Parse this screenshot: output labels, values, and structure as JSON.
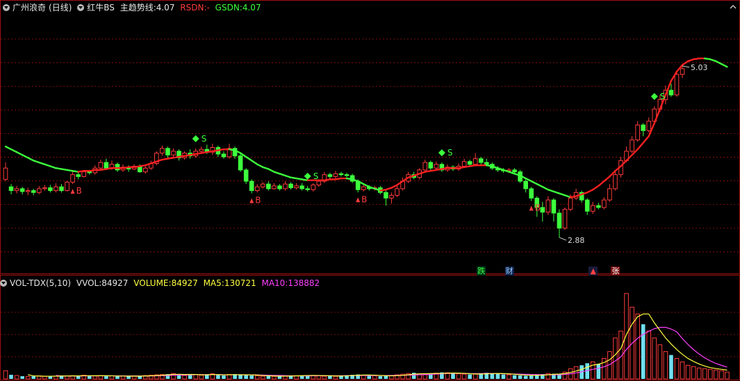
{
  "header": {
    "stock_name": "广州浪奇",
    "period": "(日线)",
    "indicator_name": "红牛BS",
    "trend_label": "主趋势线:",
    "trend_value": "4.07",
    "rsdn_label": "RSDN:",
    "rsdn_value": "-",
    "gsdn_label": "GSDN:",
    "gsdn_value": "4.07"
  },
  "volume_panel": {
    "indicator_name": "VOL-TDX(5,10)",
    "vvol_label": "VVOL:",
    "vvol_value": "84927",
    "volume_label": "VOLUME:",
    "volume_value": "84927",
    "ma5_label": "MA5:",
    "ma5_value": "130721",
    "ma10_label": "MA10:",
    "ma10_value": "138882"
  },
  "annotations": {
    "high_label": "5.03",
    "low_label": "2.88",
    "buy_label": "B",
    "sell_label": "S"
  },
  "event_badges": [
    {
      "text": "跌",
      "color": "#3cff3c",
      "bg": "#003a1a"
    },
    {
      "text": "财",
      "color": "#9ad0ff",
      "bg": "#10204a"
    },
    {
      "text": "▲",
      "color": "#ff4040",
      "bg": "#1a1a3a"
    },
    {
      "text": "张",
      "color": "#ffffff",
      "bg": "#7a0f0f"
    }
  ],
  "colors": {
    "up": "#ff3b3b",
    "down": "#3cff3c",
    "trend_up": "#ff2020",
    "trend_down": "#3cff3c",
    "volume_up": "#ff3b3b",
    "volume_down": "#70e0f0",
    "ma5": "#ffff40",
    "ma10": "#ff40ff",
    "grid": "#a01010"
  },
  "chart_data": [
    {
      "type": "candlestick",
      "title": "",
      "x_count": 130,
      "ylim": [
        2.6,
        5.25
      ],
      "price_high": 5.03,
      "price_low": 2.88,
      "candles": [
        [
          3.5,
          3.62,
          3.68,
          3.48
        ],
        [
          3.42,
          3.38,
          3.45,
          3.34
        ],
        [
          3.38,
          3.4,
          3.43,
          3.35
        ],
        [
          3.4,
          3.37,
          3.42,
          3.34
        ],
        [
          3.37,
          3.38,
          3.41,
          3.33
        ],
        [
          3.38,
          3.36,
          3.4,
          3.33
        ],
        [
          3.36,
          3.4,
          3.43,
          3.34
        ],
        [
          3.4,
          3.41,
          3.44,
          3.38
        ],
        [
          3.41,
          3.38,
          3.44,
          3.36
        ],
        [
          3.38,
          3.42,
          3.46,
          3.36
        ],
        [
          3.42,
          3.38,
          3.45,
          3.36
        ],
        [
          3.38,
          3.47,
          3.48,
          3.37
        ],
        [
          3.47,
          3.55,
          3.6,
          3.45
        ],
        [
          3.55,
          3.53,
          3.58,
          3.5
        ],
        [
          3.53,
          3.58,
          3.6,
          3.52
        ],
        [
          3.58,
          3.57,
          3.6,
          3.55
        ],
        [
          3.57,
          3.62,
          3.65,
          3.55
        ],
        [
          3.62,
          3.68,
          3.71,
          3.6
        ],
        [
          3.68,
          3.62,
          3.72,
          3.6
        ],
        [
          3.62,
          3.66,
          3.7,
          3.6
        ],
        [
          3.66,
          3.6,
          3.68,
          3.58
        ],
        [
          3.6,
          3.63,
          3.66,
          3.58
        ],
        [
          3.63,
          3.61,
          3.65,
          3.58
        ],
        [
          3.61,
          3.64,
          3.66,
          3.6
        ],
        [
          3.64,
          3.58,
          3.66,
          3.57
        ],
        [
          3.58,
          3.62,
          3.64,
          3.56
        ],
        [
          3.62,
          3.67,
          3.7,
          3.6
        ],
        [
          3.67,
          3.78,
          3.8,
          3.65
        ],
        [
          3.78,
          3.83,
          3.86,
          3.75
        ],
        [
          3.83,
          3.76,
          3.85,
          3.72
        ],
        [
          3.76,
          3.8,
          3.83,
          3.74
        ],
        [
          3.8,
          3.73,
          3.82,
          3.7
        ],
        [
          3.73,
          3.78,
          3.8,
          3.71
        ],
        [
          3.78,
          3.75,
          3.82,
          3.72
        ],
        [
          3.75,
          3.8,
          3.83,
          3.73
        ],
        [
          3.8,
          3.82,
          3.85,
          3.78
        ],
        [
          3.82,
          3.79,
          3.87,
          3.77
        ],
        [
          3.79,
          3.84,
          3.88,
          3.76
        ],
        [
          3.84,
          3.77,
          3.86,
          3.74
        ],
        [
          3.77,
          3.74,
          3.8,
          3.72
        ],
        [
          3.74,
          3.83,
          3.88,
          3.72
        ],
        [
          3.83,
          3.75,
          3.85,
          3.72
        ],
        [
          3.75,
          3.6,
          3.78,
          3.58
        ],
        [
          3.6,
          3.48,
          3.62,
          3.45
        ],
        [
          3.48,
          3.38,
          3.5,
          3.35
        ],
        [
          3.38,
          3.42,
          3.45,
          3.36
        ],
        [
          3.42,
          3.45,
          3.47,
          3.4
        ],
        [
          3.45,
          3.4,
          3.48,
          3.38
        ],
        [
          3.4,
          3.43,
          3.46,
          3.39
        ],
        [
          3.43,
          3.4,
          3.45,
          3.38
        ],
        [
          3.4,
          3.45,
          3.48,
          3.38
        ],
        [
          3.45,
          3.41,
          3.47,
          3.39
        ],
        [
          3.41,
          3.43,
          3.46,
          3.39
        ],
        [
          3.43,
          3.4,
          3.46,
          3.38
        ],
        [
          3.4,
          3.39,
          3.43,
          3.37
        ],
        [
          3.39,
          3.44,
          3.46,
          3.37
        ],
        [
          3.44,
          3.48,
          3.5,
          3.42
        ],
        [
          3.48,
          3.55,
          3.58,
          3.46
        ],
        [
          3.55,
          3.53,
          3.57,
          3.5
        ],
        [
          3.53,
          3.56,
          3.59,
          3.51
        ],
        [
          3.56,
          3.55,
          3.58,
          3.53
        ],
        [
          3.55,
          3.54,
          3.57,
          3.52
        ],
        [
          3.54,
          3.48,
          3.56,
          3.46
        ],
        [
          3.48,
          3.39,
          3.5,
          3.36
        ],
        [
          3.39,
          3.42,
          3.45,
          3.37
        ],
        [
          3.42,
          3.4,
          3.44,
          3.38
        ],
        [
          3.4,
          3.41,
          3.43,
          3.38
        ],
        [
          3.41,
          3.36,
          3.43,
          3.34
        ],
        [
          3.36,
          3.3,
          3.39,
          3.22
        ],
        [
          3.3,
          3.33,
          3.36,
          3.24
        ],
        [
          3.33,
          3.4,
          3.43,
          3.31
        ],
        [
          3.4,
          3.48,
          3.52,
          3.38
        ],
        [
          3.48,
          3.55,
          3.58,
          3.46
        ],
        [
          3.55,
          3.52,
          3.58,
          3.5
        ],
        [
          3.52,
          3.6,
          3.62,
          3.5
        ],
        [
          3.6,
          3.68,
          3.71,
          3.58
        ],
        [
          3.68,
          3.62,
          3.7,
          3.6
        ],
        [
          3.62,
          3.66,
          3.69,
          3.6
        ],
        [
          3.66,
          3.6,
          3.68,
          3.58
        ],
        [
          3.6,
          3.63,
          3.66,
          3.58
        ],
        [
          3.63,
          3.61,
          3.65,
          3.59
        ],
        [
          3.61,
          3.64,
          3.67,
          3.59
        ],
        [
          3.64,
          3.69,
          3.72,
          3.62
        ],
        [
          3.69,
          3.66,
          3.71,
          3.63
        ],
        [
          3.66,
          3.72,
          3.78,
          3.64
        ],
        [
          3.72,
          3.68,
          3.74,
          3.65
        ],
        [
          3.68,
          3.66,
          3.72,
          3.64
        ],
        [
          3.66,
          3.62,
          3.68,
          3.6
        ],
        [
          3.62,
          3.6,
          3.64,
          3.58
        ],
        [
          3.6,
          3.59,
          3.62,
          3.57
        ],
        [
          3.59,
          3.6,
          3.62,
          3.58
        ],
        [
          3.6,
          3.58,
          3.62,
          3.56
        ],
        [
          3.58,
          3.48,
          3.6,
          3.46
        ],
        [
          3.48,
          3.4,
          3.5,
          3.36
        ],
        [
          3.4,
          3.3,
          3.42,
          3.27
        ],
        [
          3.3,
          3.2,
          3.32,
          3.1
        ],
        [
          3.2,
          3.15,
          3.26,
          3.05
        ],
        [
          3.15,
          3.28,
          3.32,
          3.12
        ],
        [
          3.28,
          3.14,
          3.3,
          3.05
        ],
        [
          3.14,
          2.98,
          3.18,
          2.88
        ],
        [
          2.98,
          3.18,
          3.2,
          2.96
        ],
        [
          3.18,
          3.3,
          3.34,
          3.16
        ],
        [
          3.3,
          3.36,
          3.4,
          3.28
        ],
        [
          3.36,
          3.28,
          3.38,
          3.25
        ],
        [
          3.28,
          3.16,
          3.3,
          3.12
        ],
        [
          3.16,
          3.22,
          3.26,
          3.13
        ],
        [
          3.22,
          3.2,
          3.25,
          3.18
        ],
        [
          3.2,
          3.28,
          3.31,
          3.18
        ],
        [
          3.28,
          3.4,
          3.45,
          3.26
        ],
        [
          3.4,
          3.55,
          3.6,
          3.38
        ],
        [
          3.55,
          3.7,
          3.74,
          3.52
        ],
        [
          3.7,
          3.8,
          3.85,
          3.68
        ],
        [
          3.8,
          3.92,
          3.96,
          3.78
        ],
        [
          3.92,
          4.08,
          4.12,
          3.9
        ],
        [
          4.08,
          4.02,
          4.1,
          3.96
        ],
        [
          4.02,
          4.12,
          4.16,
          4.0
        ],
        [
          4.12,
          4.25,
          4.28,
          4.1
        ],
        [
          4.25,
          4.35,
          4.4,
          4.22
        ],
        [
          4.35,
          4.45,
          4.5,
          4.3
        ],
        [
          4.45,
          4.4,
          4.52,
          4.38
        ],
        [
          4.4,
          4.62,
          4.66,
          4.38
        ],
        [
          4.62,
          4.68,
          4.71,
          4.58
        ]
      ],
      "trend_line": [
        3.85,
        3.82,
        3.79,
        3.76,
        3.73,
        3.7,
        3.68,
        3.66,
        3.64,
        3.62,
        3.61,
        3.6,
        3.59,
        3.58,
        3.59,
        3.59,
        3.6,
        3.6,
        3.61,
        3.62,
        3.62,
        3.62,
        3.63,
        3.63,
        3.64,
        3.65,
        3.67,
        3.69,
        3.71,
        3.72,
        3.73,
        3.74,
        3.75,
        3.76,
        3.77,
        3.78,
        3.79,
        3.8,
        3.81,
        3.82,
        3.82,
        3.81,
        3.78,
        3.74,
        3.7,
        3.66,
        3.63,
        3.61,
        3.58,
        3.56,
        3.54,
        3.52,
        3.51,
        3.5,
        3.49,
        3.49,
        3.49,
        3.49,
        3.5,
        3.5,
        3.51,
        3.51,
        3.5,
        3.48,
        3.45,
        3.42,
        3.4,
        3.38,
        3.39,
        3.41,
        3.44,
        3.48,
        3.52,
        3.54,
        3.56,
        3.58,
        3.59,
        3.6,
        3.61,
        3.62,
        3.62,
        3.62,
        3.63,
        3.64,
        3.65,
        3.65,
        3.65,
        3.64,
        3.62,
        3.6,
        3.58,
        3.56,
        3.54,
        3.51,
        3.48,
        3.45,
        3.42,
        3.39,
        3.37,
        3.35,
        3.33,
        3.31,
        3.32,
        3.34,
        3.36,
        3.39,
        3.43,
        3.48,
        3.53,
        3.59,
        3.64,
        3.7,
        3.76,
        3.82,
        3.89,
        3.96,
        4.1,
        4.25,
        4.4,
        4.55,
        4.65,
        4.72,
        4.76,
        4.78,
        4.79,
        4.79,
        4.78,
        4.76,
        4.73,
        4.7
      ],
      "buy_signals": [
        12,
        44,
        63,
        94
      ],
      "sell_signals": [
        34,
        54,
        78,
        116
      ]
    },
    {
      "type": "bar",
      "title": "VOL-TDX(5,10)",
      "ylim": [
        0,
        1300000
      ],
      "volumes": [
        120000,
        60000,
        50000,
        40000,
        35000,
        40000,
        45000,
        38000,
        42000,
        40000,
        50000,
        45000,
        48000,
        40000,
        55000,
        50000,
        42000,
        48000,
        40000,
        45000,
        38000,
        42000,
        40000,
        45000,
        38000,
        50000,
        55000,
        60000,
        65000,
        70000,
        80000,
        60000,
        50000,
        70000,
        65000,
        55000,
        60000,
        75000,
        55000,
        50000,
        65000,
        70000,
        60000,
        55000,
        50000,
        45000,
        40000,
        42000,
        38000,
        40000,
        45000,
        50000,
        48000,
        52000,
        55000,
        50000,
        45000,
        40000,
        42000,
        38000,
        50000,
        55000,
        60000,
        65000,
        55000,
        50000,
        45000,
        40000,
        45000,
        50000,
        60000,
        70000,
        80000,
        90000,
        75000,
        70000,
        80000,
        85000,
        95000,
        90000,
        80000,
        75000,
        70000,
        65000,
        70000,
        80000,
        90000,
        85000,
        75000,
        65000,
        60000,
        55000,
        50000,
        45000,
        50000,
        60000,
        70000,
        80000,
        75000,
        70000,
        100000,
        150000,
        180000,
        200000,
        230000,
        250000,
        220000,
        300000,
        400000,
        600000,
        700000,
        1250000,
        1050000,
        950000,
        800000,
        700000,
        600000,
        500000,
        400000,
        350000,
        300000,
        250000,
        200000,
        180000,
        160000,
        150000,
        140000,
        130000,
        120000,
        100000
      ],
      "series": [
        {
          "name": "MA5",
          "values": []
        },
        {
          "name": "MA10",
          "values": []
        }
      ]
    }
  ]
}
